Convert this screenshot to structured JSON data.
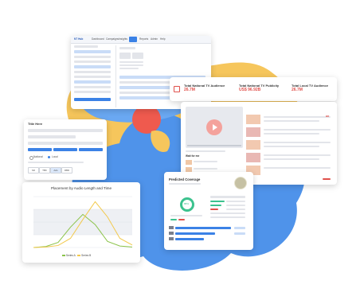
{
  "colors": {
    "blue_blob": "#4f93ea",
    "blue_blob_light": "#6aa8f2",
    "yellow_blob": "#f6c65c",
    "red_blob": "#ef5a4e",
    "accent_blue": "#3b82e6",
    "kpi_red": "#e0504b"
  },
  "top_app": {
    "logo": "NT Hub",
    "nav": [
      "Dashboard",
      "Campaigns",
      "Insights",
      "Tab",
      "Reports",
      "Admin",
      "Help"
    ]
  },
  "kpis": [
    {
      "title": "Total National TV Audience",
      "value": "26.7M"
    },
    {
      "title": "Total National TV Publicity",
      "value": "US$ 96.92B"
    },
    {
      "title": "Total Local TV Audience",
      "value": "26.7M"
    }
  ],
  "left_panel": {
    "title": "Title Here",
    "toggle_a": "National",
    "toggle_b": "Local",
    "tabs": [
      "SD",
      "TBK",
      "Ads",
      "RBD"
    ]
  },
  "chart_data": {
    "type": "line",
    "title": "Placement by Audio Length and Time",
    "xlabel": "",
    "ylabel": "",
    "series": [
      {
        "name": "Series A",
        "values": [
          0,
          2,
          10,
          40,
          65,
          45,
          12,
          3,
          1
        ]
      },
      {
        "name": "Series B",
        "values": [
          0,
          1,
          4,
          18,
          55,
          90,
          60,
          18,
          5
        ]
      }
    ],
    "x": [
      0,
      1,
      2,
      3,
      4,
      5,
      6,
      7,
      8
    ],
    "ylim": [
      0,
      100
    ],
    "grid": true,
    "legend": "bottom-center",
    "colors": [
      "#8bc34a",
      "#f2c94c"
    ]
  },
  "video_card": {
    "side_heading": "Wait for me",
    "logo_badge": "BR"
  },
  "prediction_card": {
    "title": "Predicted Coverage",
    "donut_center": "88%"
  }
}
